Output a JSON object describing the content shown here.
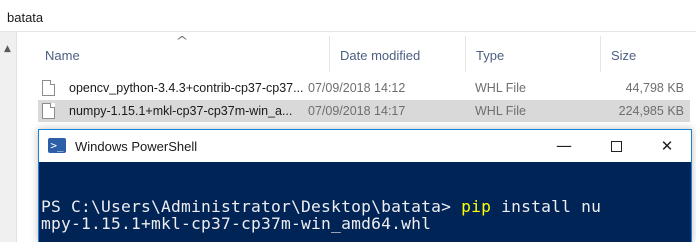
{
  "explorer": {
    "address": "batata",
    "columns": {
      "name": "Name",
      "date": "Date modified",
      "type": "Type",
      "size": "Size"
    },
    "files": [
      {
        "name": "opencv_python-3.4.3+contrib-cp37-cp37...",
        "date": "07/09/2018 14:12",
        "type": "WHL File",
        "size": "44,798 KB",
        "selected": false
      },
      {
        "name": "numpy-1.15.1+mkl-cp37-cp37m-win_a...",
        "date": "07/09/2018 14:17",
        "type": "WHL File",
        "size": "224,985 KB",
        "selected": true
      }
    ]
  },
  "powershell": {
    "title": "Windows PowerShell",
    "prompt": "PS C:\\Users\\Administrator\\Desktop\\batata> ",
    "command": "pip",
    "args_line1": " install nu",
    "line2": "mpy-1.15.1+mkl-cp37-cp37m-win_amd64.whl"
  },
  "colors": {
    "console_bg": "#012456",
    "console_fg": "#eeedf0",
    "command": "#ffff00",
    "selection": "#d9d9d9",
    "window_border": "#1883d7"
  },
  "icons": [
    "sort-ascending-icon",
    "scroll-up-icon",
    "whl-file-icon",
    "powershell-icon",
    "minimize-icon",
    "maximize-icon",
    "close-icon"
  ]
}
